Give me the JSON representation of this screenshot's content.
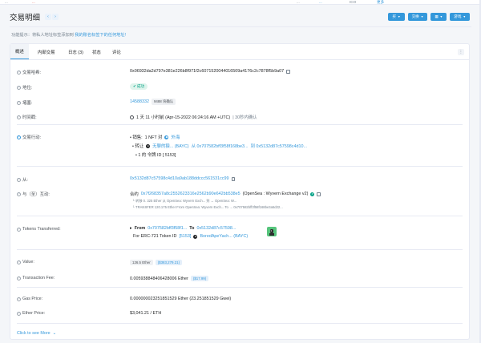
{
  "topbar": {
    "fragments": [
      {
        "text": "...",
        "cls": ""
      },
      {
        "text": "...",
        "cls": "red"
      },
      {
        "text": "...",
        "cls": ""
      },
      {
        "text": "...",
        "cls": "blue"
      },
      {
        "text": "ICO",
        "cls": ""
      },
      {
        "text": "更多",
        "cls": "blue"
      }
    ]
  },
  "page": {
    "title": "交易明细",
    "prev_glyph": "‹",
    "next_glyph": "›"
  },
  "header_buttons": [
    {
      "label": "买",
      "name": "buy-button"
    },
    {
      "label": "交换",
      "name": "exchange-button"
    },
    {
      "label": "▦",
      "name": "grid-button"
    },
    {
      "label": "游戏",
      "name": "gaming-button"
    }
  ],
  "notice": {
    "prefix": "功能提示：",
    "text": "将私人地址标签添加到",
    "link": "我的账名标签下的任何地址!"
  },
  "tabs": [
    {
      "label": "概述",
      "active": true
    },
    {
      "label": "内部交易",
      "active": false
    },
    {
      "label": "日志 (3)",
      "active": false
    },
    {
      "label": "状态",
      "active": false
    },
    {
      "label": "评论",
      "active": false
    }
  ],
  "tab_more": "⋮",
  "fields": {
    "tx_hash_label": "交易哈希:",
    "tx_hash": "0x06932da2d797e381e226b8f971f2c6071520044016509a4176c2c7878f5b9a07",
    "status_label": "地位:",
    "status": "成功",
    "block_label": "堵塞:",
    "block": "14588332",
    "block_confirm": "9488 块确认",
    "timestamp_label": "时间戳:",
    "timestamp": "1 天 11 小时前 (Apr-15-2022 06:24:16 AM +UTC)",
    "timestamp_confirm": "| 30秒内确认",
    "action_label": "交易行动:",
    "action_line1_prefix": "• 销售:",
    "action_line1_qty": "1 NFT 对",
    "action_line1_market": "外海",
    "action_line2_prefix": "• 转让",
    "action_line2_token": "无聊的猿... (BAYC)",
    "action_line2_from": "从 0x707582bff3f58f168be3...",
    "action_line2_to": "到 0x5132d87c57598c4d10...",
    "action_line3": "• 1 的 令牌 ID [ 5153]",
    "from_label": "从:",
    "from": "0x5132d87c57598c4d10a9ab188ddccc561531cc99",
    "interact_label": "与（至）互动:",
    "interact_contract_prefix": "合约",
    "interact_contract": "0x7f268357a8c2552623316e2562b90e642bb538e5",
    "interact_name": "(OpenSea : Wyvern Exchange v2)",
    "internal1": "└ 转移 0. 325 Ether 从 OpenSea: Wyvern Exch... 到 ↔ OpenSea: W...",
    "internal2": "└ TRANSFER 120.175 Ether From OpenSea: Wyvern Exch... To → 0x707582bff3f58f168be3a5d22...",
    "tokens_label": "Tokens Transferred:",
    "tokens_from_word": "From",
    "tokens_from": "0x707582bff3f58f1...",
    "tokens_to_word": "To",
    "tokens_to": "0x5132d87c57598...",
    "tokens_for": "For ERC-721 Token ID",
    "tokens_id": "[5153]",
    "tokens_name": "BoredApeYach... (BAYC)",
    "value_label": "Value:",
    "value": "126.5 Ether",
    "value_usd": "($383,279.21)",
    "fee_label": "Transaction Fee:",
    "fee": "0.005938848406428006 Ether",
    "fee_usd": "($17.99)",
    "gas_label": "Gas Price:",
    "gas": "0.000000023251851529 Ether (23.251851529 Gwei)",
    "eth_label": "Ether Price:",
    "eth": "$3,041.21 / ETH"
  },
  "see_more": "Click to see More",
  "colors": {
    "accent": "#3498db",
    "success": "#00a186",
    "text": "#1e2022"
  }
}
